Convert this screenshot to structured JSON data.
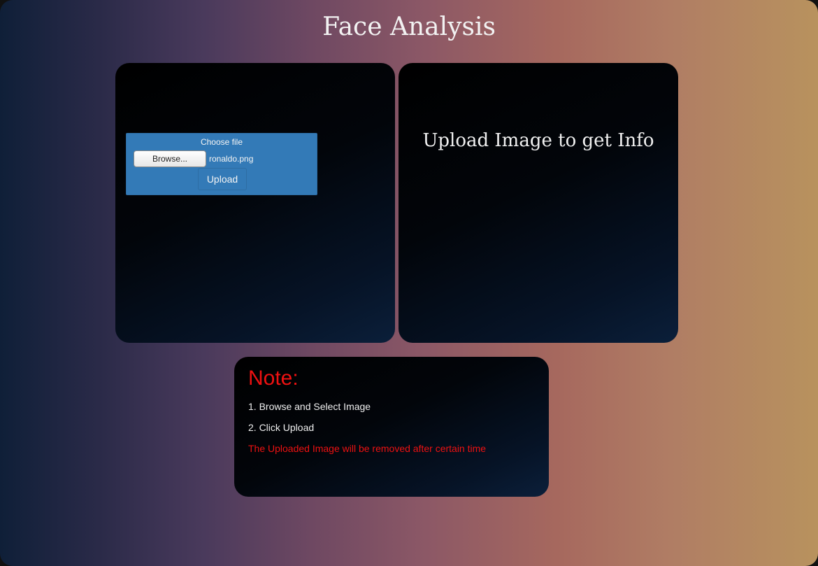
{
  "header": {
    "title": "Face Analysis"
  },
  "upload_form": {
    "choose_label": "Choose file",
    "browse_label": "Browse...",
    "selected_file": "ronaldo.png",
    "upload_label": "Upload"
  },
  "info_panel": {
    "message": "Upload Image to get Info"
  },
  "note": {
    "heading": "Note:",
    "steps": [
      "1. Browse and Select Image",
      "2. Click Upload"
    ],
    "warning": "The Uploaded Image will be removed after certain time"
  },
  "colors": {
    "accent_blue": "#337ab7",
    "warning_red": "#ee1111"
  }
}
